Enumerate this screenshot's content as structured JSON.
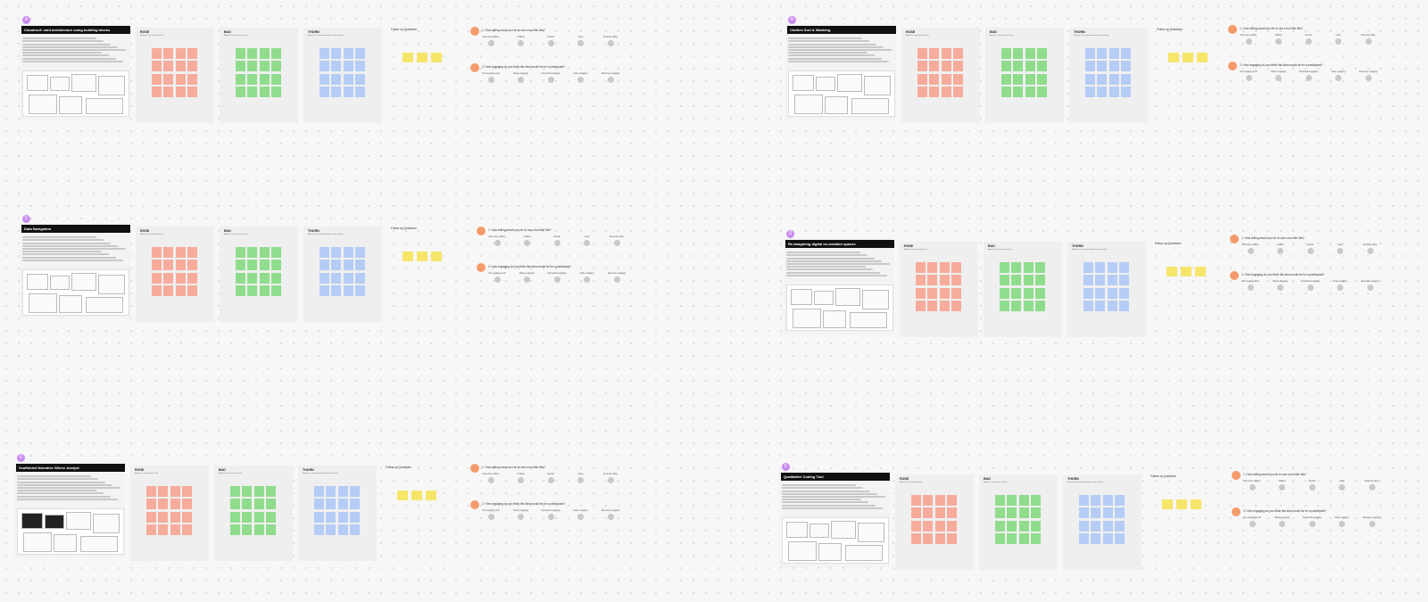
{
  "columns": {
    "rose": {
      "title": "ROSE",
      "subtitle": "Aspects I am excited to do"
    },
    "bud": {
      "title": "BUD",
      "subtitle": "Aspects I am curious to try"
    },
    "thorn": {
      "title": "THORN",
      "subtitle": "Aspects I am worried about or do not like"
    }
  },
  "followup_title": "Follow up Questions",
  "question1": "1. How willing would you be to use a tool like this?",
  "question1_options": [
    "Extremely unlikely",
    "Unlikely",
    "Neutral",
    "Likely",
    "Extremely likely"
  ],
  "question2": "2. How engaging do you think this idea would be for a participant?",
  "question2_options": [
    "Not engaging at all",
    "Barely engaging",
    "Somewhat engaging",
    "Fairly engaging",
    "Extremely engaging"
  ],
  "groups": [
    {
      "badge": "A",
      "title": "Cloudroof: card architecture using building blocks"
    },
    {
      "badge": "B",
      "title": "Clothes Sort & Washing"
    },
    {
      "badge": "C",
      "title": "Data Navigation"
    },
    {
      "badge": "D",
      "title": "Re-Imagining digital co-creation spaces"
    },
    {
      "badge": "E",
      "title": "Scaffolded Narrative Where Analyst"
    },
    {
      "badge": "F",
      "title": "Qualitative Coding Tool"
    }
  ],
  "colors": {
    "rose": "#f6ab9b",
    "bud": "#8fdc8d",
    "thorn": "#b5ccf6",
    "followup": "#f7e56a",
    "question_dot": "#f59b6b",
    "badge": "#c98bf0"
  }
}
